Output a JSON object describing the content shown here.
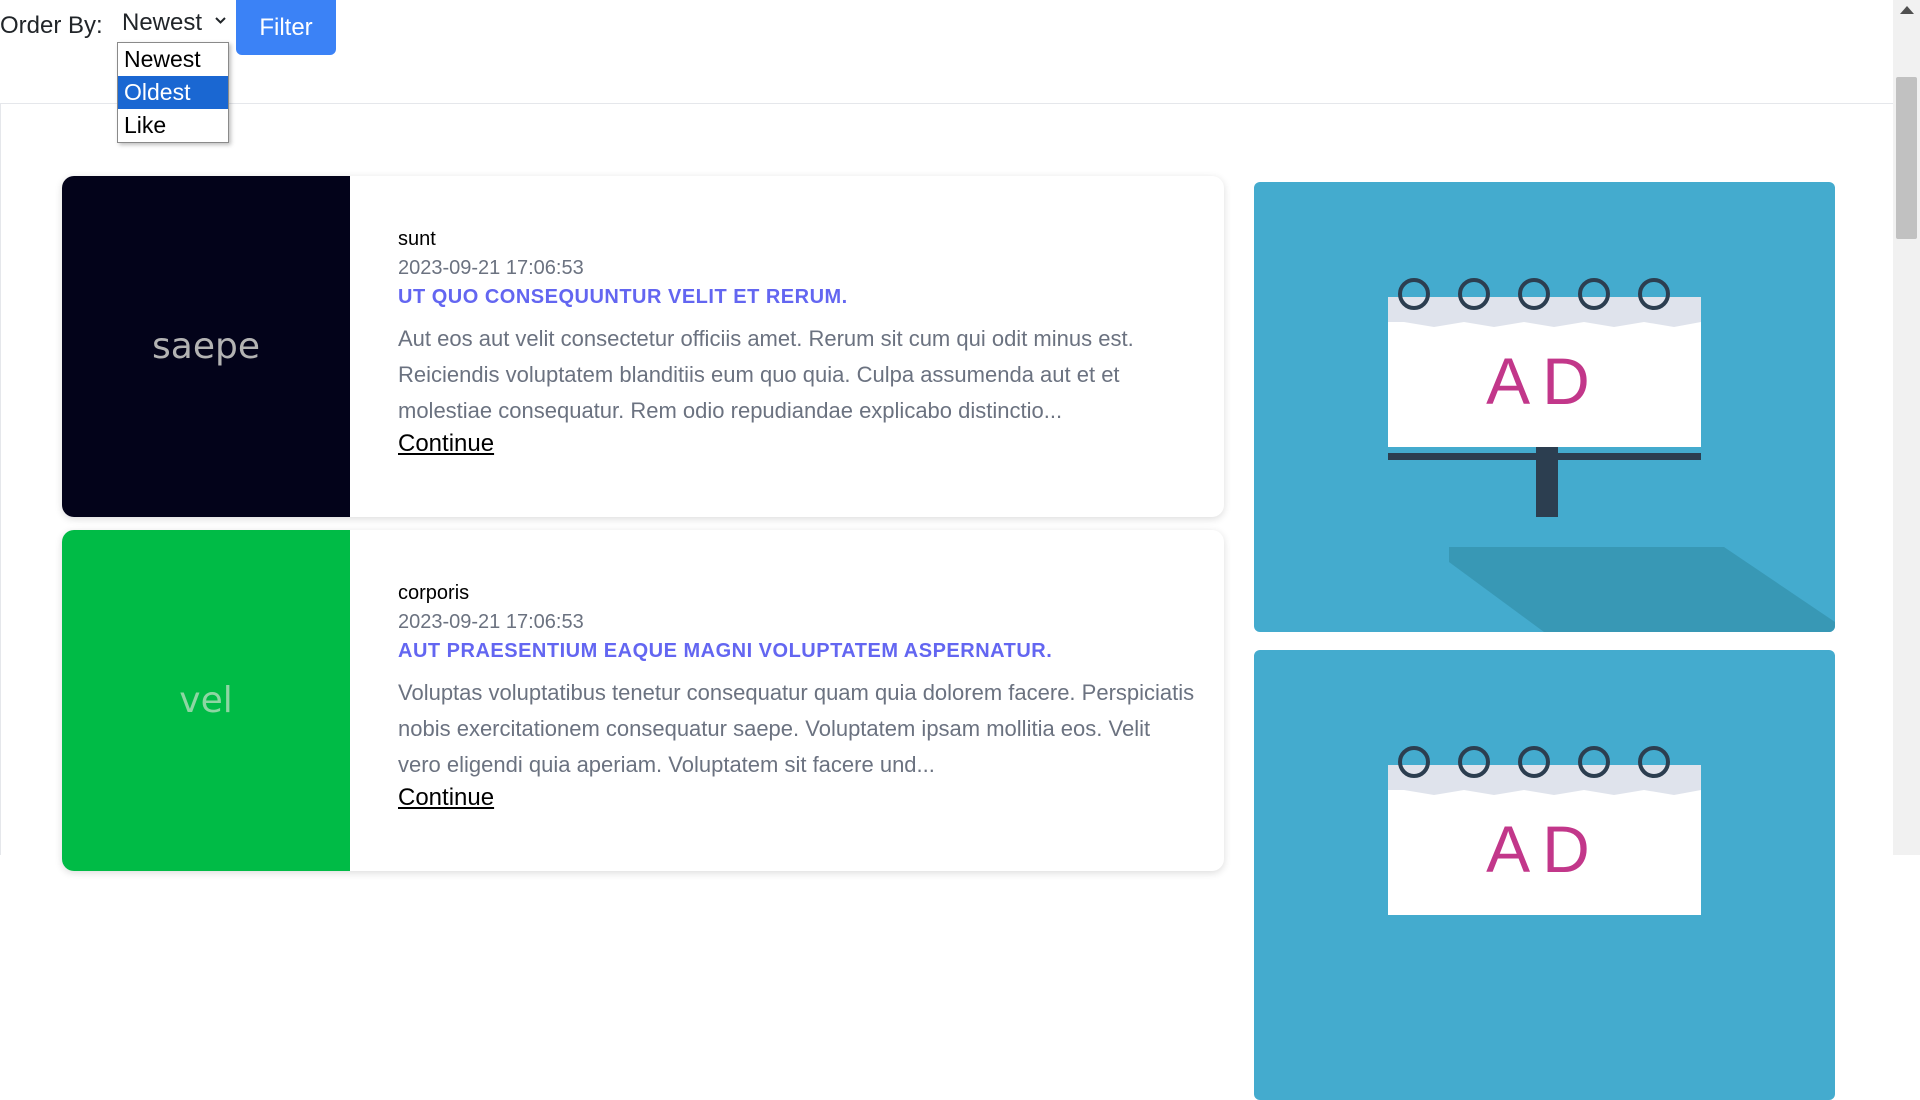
{
  "toolbar": {
    "order_label": "Order By:",
    "selected_value": "Newest",
    "filter_label": "Filter"
  },
  "dropdown": {
    "options": [
      "Newest",
      "Oldest",
      "Like"
    ],
    "highlighted": "Oldest"
  },
  "posts": [
    {
      "thumb_text": "saepe",
      "thumb_bg": "#03031a",
      "thumb_color": "#b3b3b3",
      "author": "sunt",
      "date": "2023-09-21 17:06:53",
      "title": "UT QUO CONSEQUUNTUR VELIT ET RERUM.",
      "excerpt": "Aut eos aut velit consectetur officiis amet. Rerum sit cum qui odit minus est. Reiciendis voluptatem blanditiis eum quo quia. Culpa assumenda aut et et molestiae consequatur. Rem odio repudiandae explicabo distinctio...",
      "link": "Continue"
    },
    {
      "thumb_text": "vel",
      "thumb_bg": "#00bb46",
      "thumb_color": "#8ed6a3",
      "author": "corporis",
      "date": "2023-09-21 17:06:53",
      "title": "AUT PRAESENTIUM EAQUE MAGNI VOLUPTATEM ASPERNATUR.",
      "excerpt": "Voluptas voluptatibus tenetur consequatur quam quia dolorem facere. Perspiciatis nobis exercitationem consequatur saepe. Voluptatem ipsam mollitia eos. Velit vero eligendi quia aperiam. Voluptatem sit facere und...",
      "link": "Continue"
    }
  ],
  "ads": [
    {
      "text": "AD"
    },
    {
      "text": "AD"
    }
  ],
  "colors": {
    "accent": "#3b82f6",
    "title": "#6366f1",
    "ad_bg": "#44abce",
    "ad_text": "#c2378a"
  }
}
